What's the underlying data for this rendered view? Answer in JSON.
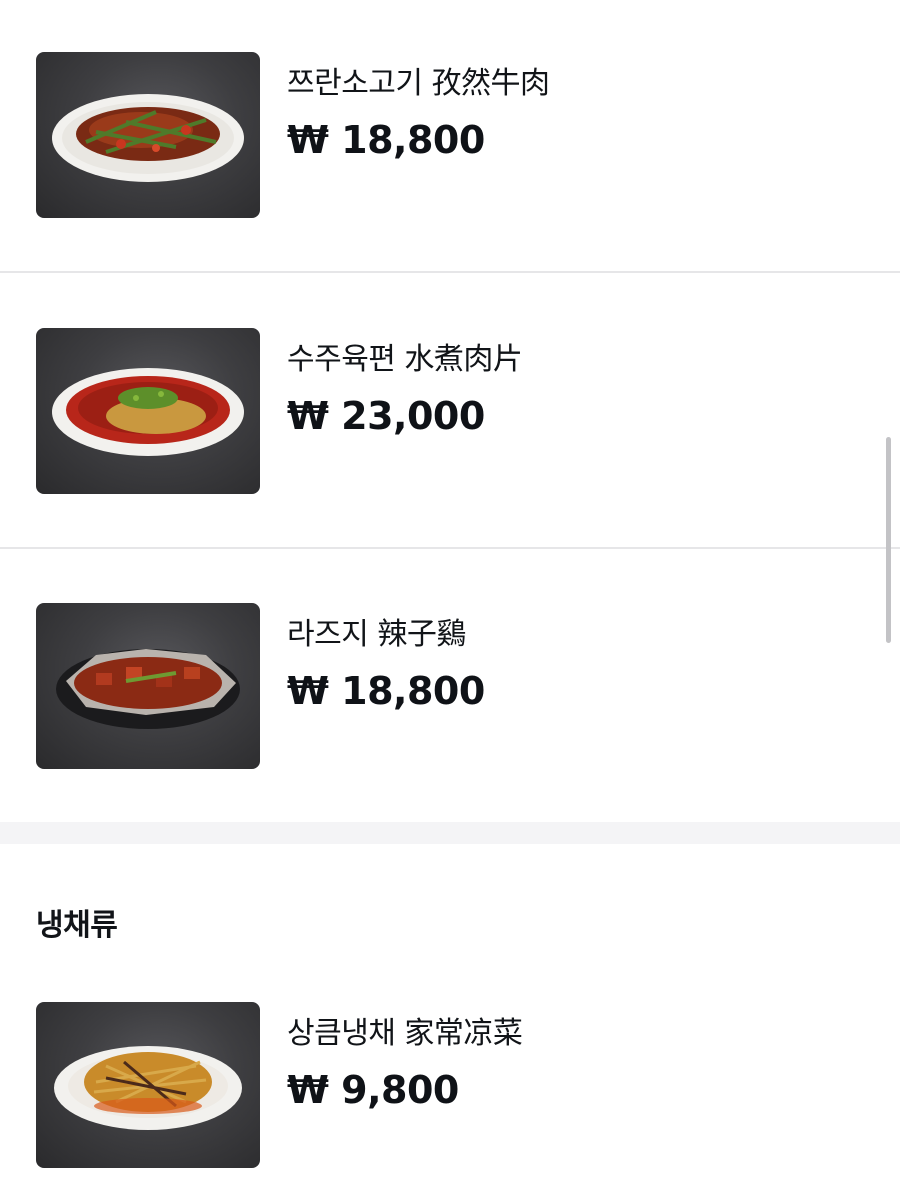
{
  "menu": {
    "items": [
      {
        "name": "쯔란소고기 孜然牛肉",
        "price": "₩ 18,800",
        "image_icon": "cumin-beef-dish-photo"
      },
      {
        "name": "수주육편 水煮肉片",
        "price": "₩ 23,000",
        "image_icon": "boiled-pork-slices-dish-photo"
      },
      {
        "name": "라즈지 辣子鷄",
        "price": "₩ 18,800",
        "image_icon": "spicy-chicken-dish-photo"
      }
    ],
    "section": {
      "title": "냉채류",
      "items": [
        {
          "name": "상큼냉채 家常凉菜",
          "price": "₩ 9,800",
          "image_icon": "cold-salad-dish-photo"
        }
      ]
    }
  }
}
